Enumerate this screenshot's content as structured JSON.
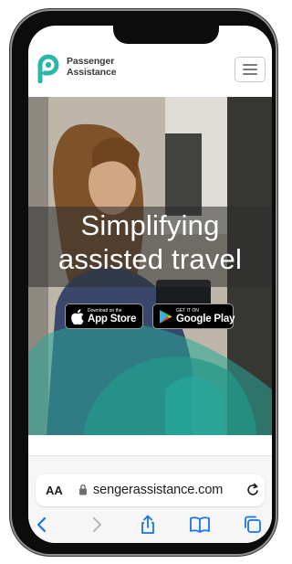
{
  "header": {
    "logo_line1": "Passenger",
    "logo_line2": "Assistance",
    "menu_icon": "hamburger-menu-icon"
  },
  "hero": {
    "title_line1": "Simplifying",
    "title_line2": "assisted travel",
    "apple_badge": {
      "small": "Download on the",
      "big": "App Store",
      "icon": "apple-icon"
    },
    "google_badge": {
      "small": "GET IT ON",
      "big": "Google Play",
      "icon": "google-play-icon"
    }
  },
  "browser": {
    "text_size_label": "AA",
    "url": "sengerassistance.com",
    "toolbar": [
      "back-icon",
      "forward-icon",
      "share-icon",
      "bookmarks-icon",
      "tabs-icon"
    ]
  },
  "colors": {
    "brand_teal": "#2bb7a8",
    "toolbar_blue": "#1a73e8",
    "text_dark": "#3a3a3a"
  }
}
